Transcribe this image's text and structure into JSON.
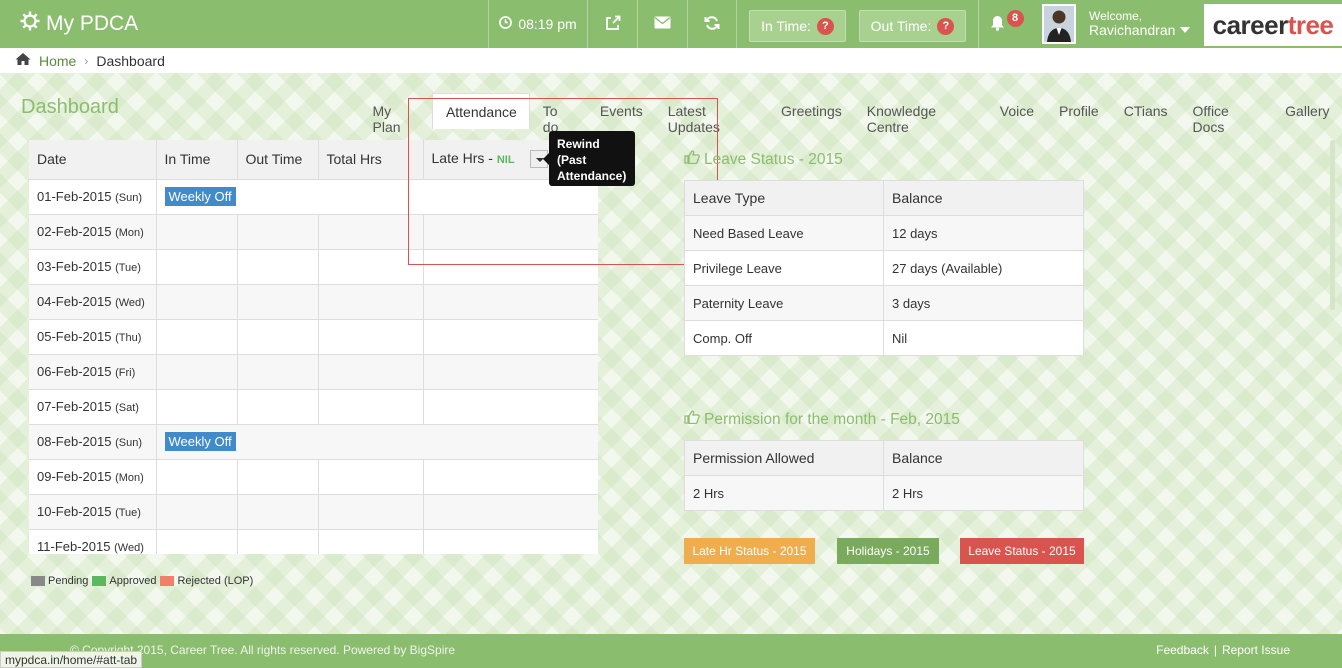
{
  "header": {
    "app_title": "My PDCA",
    "time": "08:19 pm",
    "in_time_label": "In Time:",
    "in_time_badge": "?",
    "out_time_label": "Out Time:",
    "out_time_badge": "?",
    "notifications_count": "8",
    "welcome_label": "Welcome,",
    "user_name": "Ravichandran",
    "brand_pre": "career",
    "brand_post": "tree"
  },
  "breadcrumb": {
    "home": "Home",
    "current": "Dashboard"
  },
  "page_title": "Dashboard",
  "tabs": [
    "My Plan",
    "Attendance",
    "To do",
    "Events",
    "Latest Updates",
    "Greetings",
    "Knowledge Centre",
    "Voice",
    "Profile",
    "CTians",
    "Office Docs",
    "Gallery"
  ],
  "active_tab": "Attendance",
  "tooltip": "Rewind (Past Attendance)",
  "attendance": {
    "columns": [
      "Date",
      "In Time",
      "Out Time",
      "Total Hrs",
      "Late Hrs - "
    ],
    "late_hrs_value": "NIL",
    "rows": [
      {
        "date": "01-Feb-2015",
        "day": "(Sun)",
        "status": "Weekly Off"
      },
      {
        "date": "02-Feb-2015",
        "day": "(Mon)",
        "status": ""
      },
      {
        "date": "03-Feb-2015",
        "day": "(Tue)",
        "status": ""
      },
      {
        "date": "04-Feb-2015",
        "day": "(Wed)",
        "status": ""
      },
      {
        "date": "05-Feb-2015",
        "day": "(Thu)",
        "status": ""
      },
      {
        "date": "06-Feb-2015",
        "day": "(Fri)",
        "status": ""
      },
      {
        "date": "07-Feb-2015",
        "day": "(Sat)",
        "status": ""
      },
      {
        "date": "08-Feb-2015",
        "day": "(Sun)",
        "status": "Weekly Off"
      },
      {
        "date": "09-Feb-2015",
        "day": "(Mon)",
        "status": ""
      },
      {
        "date": "10-Feb-2015",
        "day": "(Tue)",
        "status": ""
      },
      {
        "date": "11-Feb-2015",
        "day": "(Wed)",
        "status": ""
      }
    ]
  },
  "legend": [
    {
      "label": "Pending",
      "color": "#888888"
    },
    {
      "label": "Approved",
      "color": "#5cb85c"
    },
    {
      "label": "Rejected (LOP)",
      "color": "#f0806a"
    }
  ],
  "leave_status": {
    "title": "Leave Status - 2015",
    "columns": [
      "Leave Type",
      "Balance"
    ],
    "rows": [
      [
        "Need Based Leave",
        "12 days"
      ],
      [
        "Privilege Leave",
        "27 days (Available)"
      ],
      [
        "Paternity Leave",
        "3 days"
      ],
      [
        "Comp. Off",
        "Nil"
      ]
    ]
  },
  "permission": {
    "title": "Permission for the month - Feb, 2015",
    "columns": [
      "Permission Allowed",
      "Balance"
    ],
    "rows": [
      [
        "2 Hrs",
        "2 Hrs"
      ]
    ]
  },
  "status_buttons": [
    {
      "label": "Late Hr Status - 2015",
      "color": "#f0ad4e"
    },
    {
      "label": "Holidays - 2015",
      "color": "#7aab5c"
    },
    {
      "label": "Leave Status - 2015",
      "color": "#d9534f"
    }
  ],
  "footer": {
    "copyright": "© Copyright 2015, Career Tree. All rights reserved. Powered by BigSpire",
    "feedback": "Feedback",
    "separator": "|",
    "report": "Report Issue"
  },
  "status_url": "mypdca.in/home/#att-tab"
}
